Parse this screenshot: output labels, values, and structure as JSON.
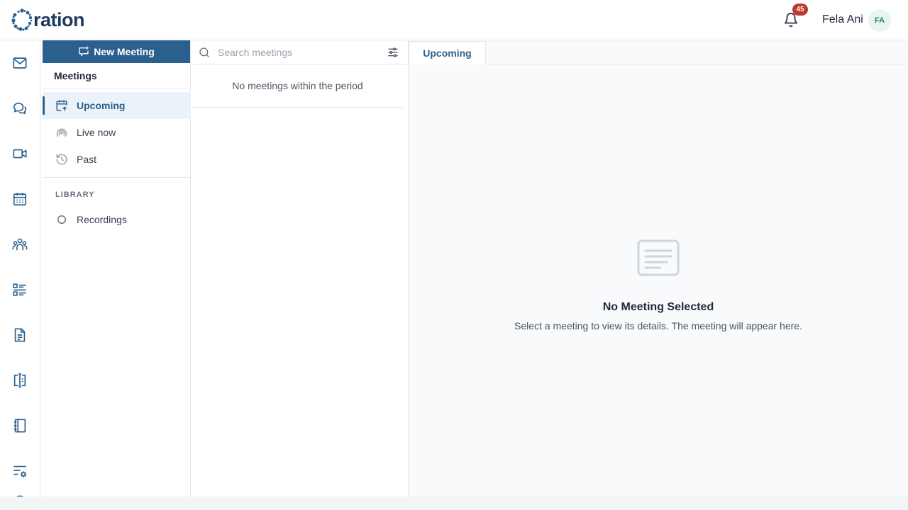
{
  "header": {
    "logo_text": "ration",
    "notification_count": "45",
    "user_name": "Fela Ani",
    "user_initials": "FA"
  },
  "rail": {
    "icons": [
      "mail-icon",
      "chat-icon",
      "video-icon",
      "calendar-icon",
      "team-icon",
      "tasks-list-icon",
      "document-icon",
      "forms-icon",
      "notebook-icon",
      "settings-list-icon"
    ]
  },
  "sidebar": {
    "new_button_label": "New Meeting",
    "title": "Meetings",
    "items": [
      {
        "label": "Upcoming",
        "icon": "calendar-upcoming-icon",
        "active": true
      },
      {
        "label": "Live now",
        "icon": "broadcast-icon",
        "active": false
      },
      {
        "label": "Past",
        "icon": "history-icon",
        "active": false
      }
    ],
    "library_heading": "LIBRARY",
    "library_items": [
      {
        "label": "Recordings",
        "icon": "circle-icon"
      }
    ]
  },
  "list": {
    "search_placeholder": "Search meetings",
    "empty_message": "No meetings within the period"
  },
  "detail": {
    "tab_label": "Upcoming",
    "empty_title": "No Meeting Selected",
    "empty_subtitle": "Select a meeting to view its details. The meeting will appear here."
  },
  "colors": {
    "primary": "#2b5f8e",
    "badge": "#c0392b",
    "avatar_bg": "#e8f5ee",
    "avatar_text": "#2f855a"
  }
}
